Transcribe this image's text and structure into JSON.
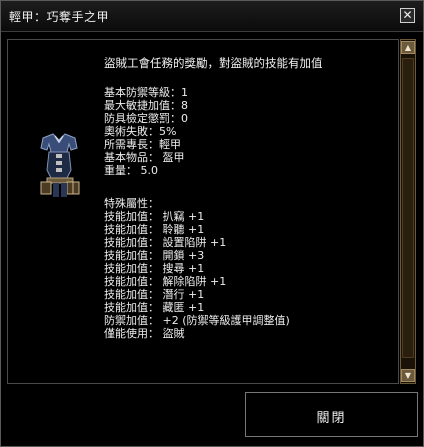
{
  "window": {
    "title": "輕甲：巧奪手之甲",
    "close_icon_glyph": "✕"
  },
  "item": {
    "description": "盜賊工會任務的獎勵，對盜賊的技能有加值",
    "stats": [
      "基本防禦等級：1",
      "最大敏捷加值：8",
      "防具檢定懲罰：0",
      "奧術失敗：5%",
      "所需專長：輕甲",
      "基本物品： 盔甲",
      "重量： 5.0"
    ],
    "special_header": "特殊屬性：",
    "special": [
      "技能加值： 扒竊 +1",
      "技能加值： 聆聽 +1",
      "技能加值： 設置陷阱 +1",
      "技能加值： 開鎖 +3",
      "技能加值： 搜尋 +1",
      "技能加值： 解除陷阱 +1",
      "技能加值： 潛行 +1",
      "技能加值： 藏匿 +1",
      "防禦加值： +2 (防禦等級護甲調整值)",
      "僅能使用： 盜賊"
    ],
    "icon": "leather-armor-icon"
  },
  "buttons": {
    "close_label": "關閉"
  },
  "scrollbar": {
    "up_glyph": "▲",
    "down_glyph": "▼"
  },
  "colors": {
    "background": "#000000",
    "border": "#5a5a5a",
    "scrollbar_accent": "#6b5a3c"
  }
}
